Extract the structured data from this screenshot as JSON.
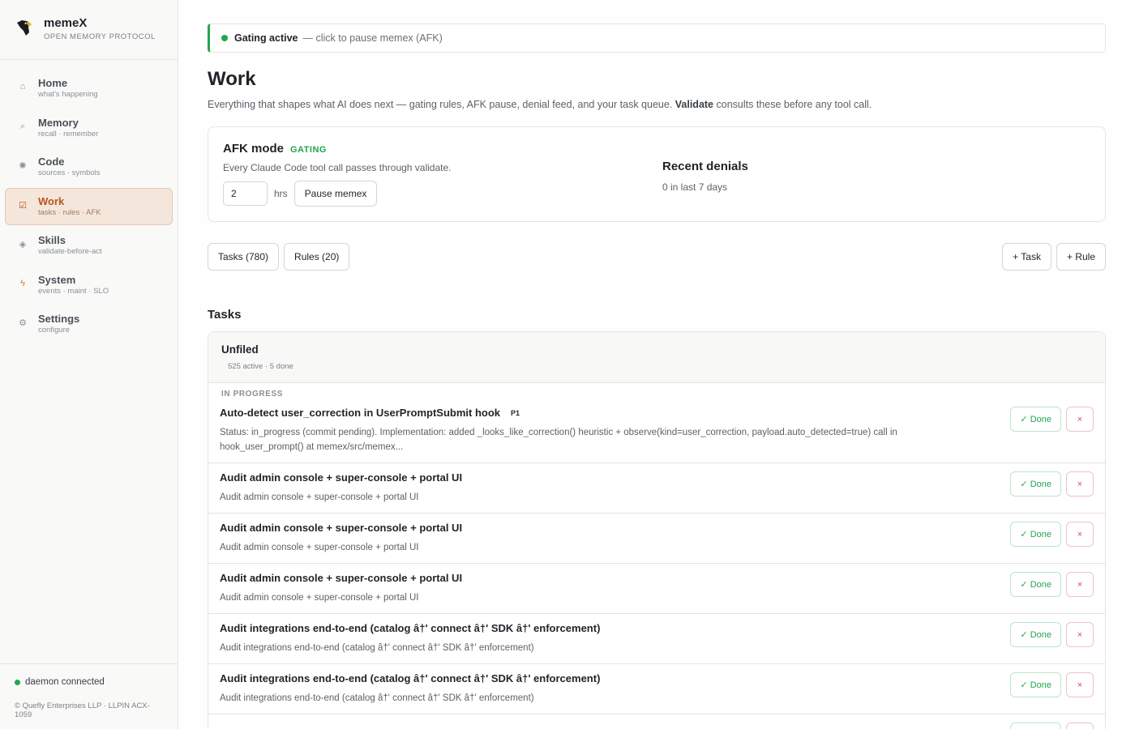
{
  "brand": {
    "name": "memeX",
    "subtitle": "OPEN MEMORY PROTOCOL",
    "logo_icon": "bird-logo"
  },
  "sidebar": {
    "items": [
      {
        "label": "Home",
        "sub": "what's happening",
        "icon": "home-icon",
        "glyph": "⌂",
        "active": false
      },
      {
        "label": "Memory",
        "sub": "recall · remember",
        "icon": "search-icon",
        "glyph": "⌕",
        "active": false
      },
      {
        "label": "Code",
        "sub": "sources · symbols",
        "icon": "code-icon",
        "glyph": "✺",
        "active": false
      },
      {
        "label": "Work",
        "sub": "tasks · rules · AFK",
        "icon": "checkbox-icon",
        "glyph": "☑",
        "active": true
      },
      {
        "label": "Skills",
        "sub": "validate-before-act",
        "icon": "diamond-icon",
        "glyph": "◈",
        "active": false
      },
      {
        "label": "System",
        "sub": "events · maint · SLO",
        "icon": "bolt-icon",
        "glyph": "ϟ",
        "active": false
      },
      {
        "label": "Settings",
        "sub": "configure",
        "icon": "gear-icon",
        "glyph": "⚙",
        "active": false
      }
    ],
    "footer": {
      "status": "daemon connected",
      "copyright": "© Quefly Enterprises LLP · LLPIN ACX-1059"
    }
  },
  "gating": {
    "title": "Gating active",
    "hint": "— click to pause memex (AFK)"
  },
  "page": {
    "title": "Work",
    "desc_before": "Everything that shapes what AI does next — gating rules, AFK pause, denial feed, and your task queue. ",
    "desc_bold": "Validate",
    "desc_after": " consults these before any tool call."
  },
  "afk": {
    "title": "AFK mode",
    "badge": "GATING",
    "desc": "Every Claude Code tool call passes through validate.",
    "hours_value": "2",
    "hours_label": "hrs",
    "pause_label": "Pause memex"
  },
  "denials": {
    "title": "Recent denials",
    "sub": "0 in last 7 days"
  },
  "tabs": {
    "tasks": "Tasks (780)",
    "rules": "Rules (20)",
    "add_task": "+ Task",
    "add_rule": "+ Rule"
  },
  "tasks_section": {
    "title": "Tasks",
    "group": {
      "name": "Unfiled",
      "meta": "525 active · 5 done",
      "status_label": "IN PROGRESS"
    },
    "done_label": "✓ Done",
    "delete_label": "×",
    "items": [
      {
        "title": "Auto-detect user_correction in UserPromptSubmit hook",
        "priority": "P1",
        "desc": "Status: in_progress (commit pending). Implementation: added _looks_like_correction() heuristic + observe(kind=user_correction, payload.auto_detected=true) call in hook_user_prompt() at memex/src/memex..."
      },
      {
        "title": "Audit admin console + super-console + portal UI",
        "priority": "",
        "desc": "Audit admin console + super-console + portal UI"
      },
      {
        "title": "Audit admin console + super-console + portal UI",
        "priority": "",
        "desc": "Audit admin console + super-console + portal UI"
      },
      {
        "title": "Audit admin console + super-console + portal UI",
        "priority": "",
        "desc": "Audit admin console + super-console + portal UI"
      },
      {
        "title": "Audit integrations end-to-end (catalog â†' connect â†' SDK â†' enforcement)",
        "priority": "",
        "desc": "Audit integrations end-to-end (catalog â†' connect â†' SDK â†' enforcement)"
      },
      {
        "title": "Audit integrations end-to-end (catalog â†' connect â†' SDK â†' enforcement)",
        "priority": "",
        "desc": "Audit integrations end-to-end (catalog â†' connect â†' SDK â†' enforcement)"
      },
      {
        "title": "",
        "priority": "",
        "desc": ""
      }
    ]
  },
  "colors": {
    "accent": "#b5561c",
    "active_bg": "#f5e6dc",
    "success": "#23a64f",
    "danger": "#d24b57"
  }
}
